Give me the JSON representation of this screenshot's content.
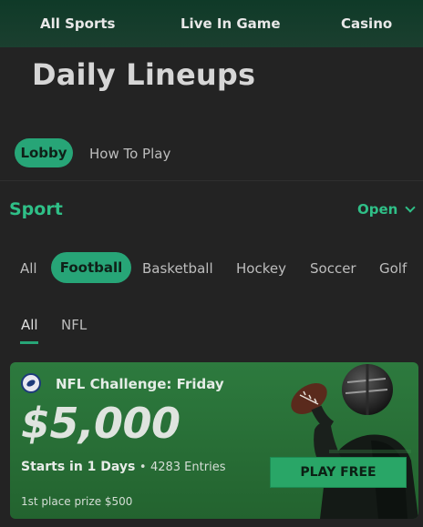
{
  "topnav": {
    "items": [
      "All Sports",
      "Live In Game",
      "Casino"
    ]
  },
  "page_title": "Daily Lineups",
  "subnav": {
    "lobby": "Lobby",
    "how_to_play": "How To Play"
  },
  "sport_section": {
    "title": "Sport",
    "toggle": "Open",
    "toggle_icon": "chevron-down-icon"
  },
  "sport_tabs": [
    "All",
    "Football",
    "Basketball",
    "Hockey",
    "Soccer",
    "Golf"
  ],
  "selected_sport": "Football",
  "league_tabs": [
    "All",
    "NFL"
  ],
  "selected_league": "All",
  "promo": {
    "title": "NFL Challenge: Friday",
    "amount": "$5,000",
    "starts": "Starts in 1 Days",
    "separator": "•",
    "entries": "4283 Entries",
    "prize": "1st place prize $500",
    "cta": "PLAY FREE",
    "logo_icon": "football-logo-icon"
  },
  "colors": {
    "accent": "#27a577",
    "accent_text": "#2fbf87",
    "background": "#232323",
    "topnav": "#163d2c",
    "promo_bg": "#2a6f38"
  }
}
